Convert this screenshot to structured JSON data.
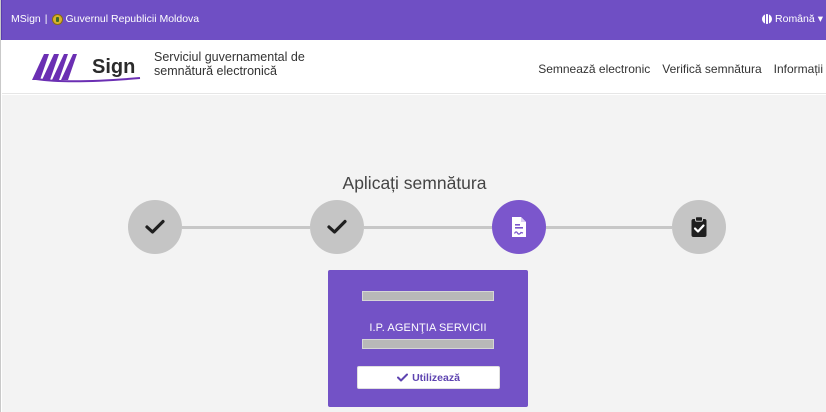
{
  "topbar": {
    "app_name": "MSign",
    "separator": "|",
    "government": "Guvernul Republicii Moldova",
    "language": "Română",
    "language_caret": "▾"
  },
  "header": {
    "logo_text": "Sign",
    "tagline_line1": "Serviciul guvernamental de",
    "tagline_line2": "semnătură electronică",
    "nav": [
      "Semnează electronic",
      "Verifică semnătura",
      "Informații"
    ]
  },
  "main": {
    "title": "Aplicați semnătura",
    "steps": [
      {
        "icon": "check-icon",
        "state": "done"
      },
      {
        "icon": "check-icon",
        "state": "done"
      },
      {
        "icon": "signed-document-icon",
        "state": "active"
      },
      {
        "icon": "clipboard-check-icon",
        "state": "pending"
      }
    ],
    "certificate": {
      "organization": "I.P. AGENŢIA SERVICII",
      "use_button": "Utilizează"
    }
  },
  "colors": {
    "brand_purple": "#6f4fc4",
    "active_step": "#7b56cc",
    "inactive_step": "#c5c5c5",
    "card": "#7352c6",
    "background": "#f3f3f3"
  }
}
